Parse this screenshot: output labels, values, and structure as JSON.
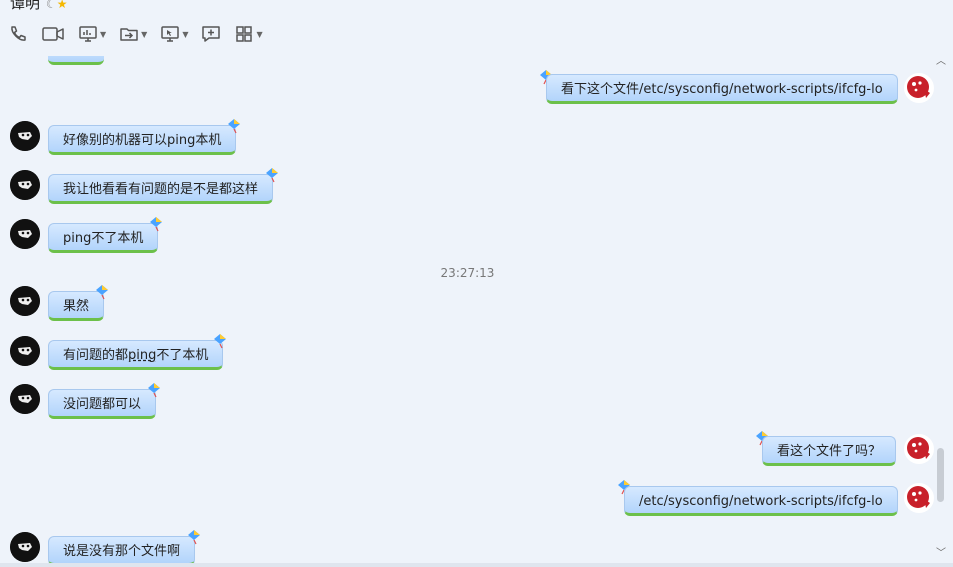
{
  "header": {
    "contact_name": "谭明",
    "moon_glyph": "☾",
    "star_glyph": "★"
  },
  "toolbar": {
    "buttons": [
      {
        "name": "phone-call",
        "icon": "phone-icon"
      },
      {
        "name": "video-call",
        "icon": "video-icon"
      },
      {
        "name": "screen-share",
        "icon": "monitor-icon",
        "has_menu": true
      },
      {
        "name": "send-file",
        "icon": "folder-send-icon",
        "has_menu": true
      },
      {
        "name": "remote-assist",
        "icon": "remote-desktop-icon",
        "has_menu": true
      },
      {
        "name": "new-chat",
        "icon": "add-message-icon"
      },
      {
        "name": "apps",
        "icon": "apps-grid-icon",
        "has_menu": true
      }
    ]
  },
  "messages": [
    {
      "side": "right",
      "text": "看下这个文件/etc/sysconfig/network-scripts/ifcfg-lo"
    },
    {
      "side": "left",
      "text": "好像别的机器可以ping本机"
    },
    {
      "side": "left",
      "text": "我让他看看有问题的是不是都这样"
    },
    {
      "side": "left",
      "text": "ping不了本机"
    },
    {
      "side": "timestamp",
      "text": "23:27:13"
    },
    {
      "side": "left",
      "text": "果然"
    },
    {
      "side": "left",
      "text_pre": "有问题的都",
      "text_u": "ping",
      "text_post": "不了本机"
    },
    {
      "side": "left",
      "text": "没问题都可以"
    },
    {
      "side": "right",
      "text": "看这个文件了吗？"
    },
    {
      "side": "right",
      "text": "/etc/sysconfig/network-scripts/ifcfg-lo"
    },
    {
      "side": "left",
      "text": "说是没有那个文件啊"
    }
  ],
  "scrollbar": {
    "up": "︿",
    "down": "﹀"
  },
  "colors": {
    "background": "#eef3fa",
    "bubble_top": "#d6e9ff",
    "bubble_bottom": "#b2d4fb",
    "bubble_accent": "#6cc04a"
  }
}
